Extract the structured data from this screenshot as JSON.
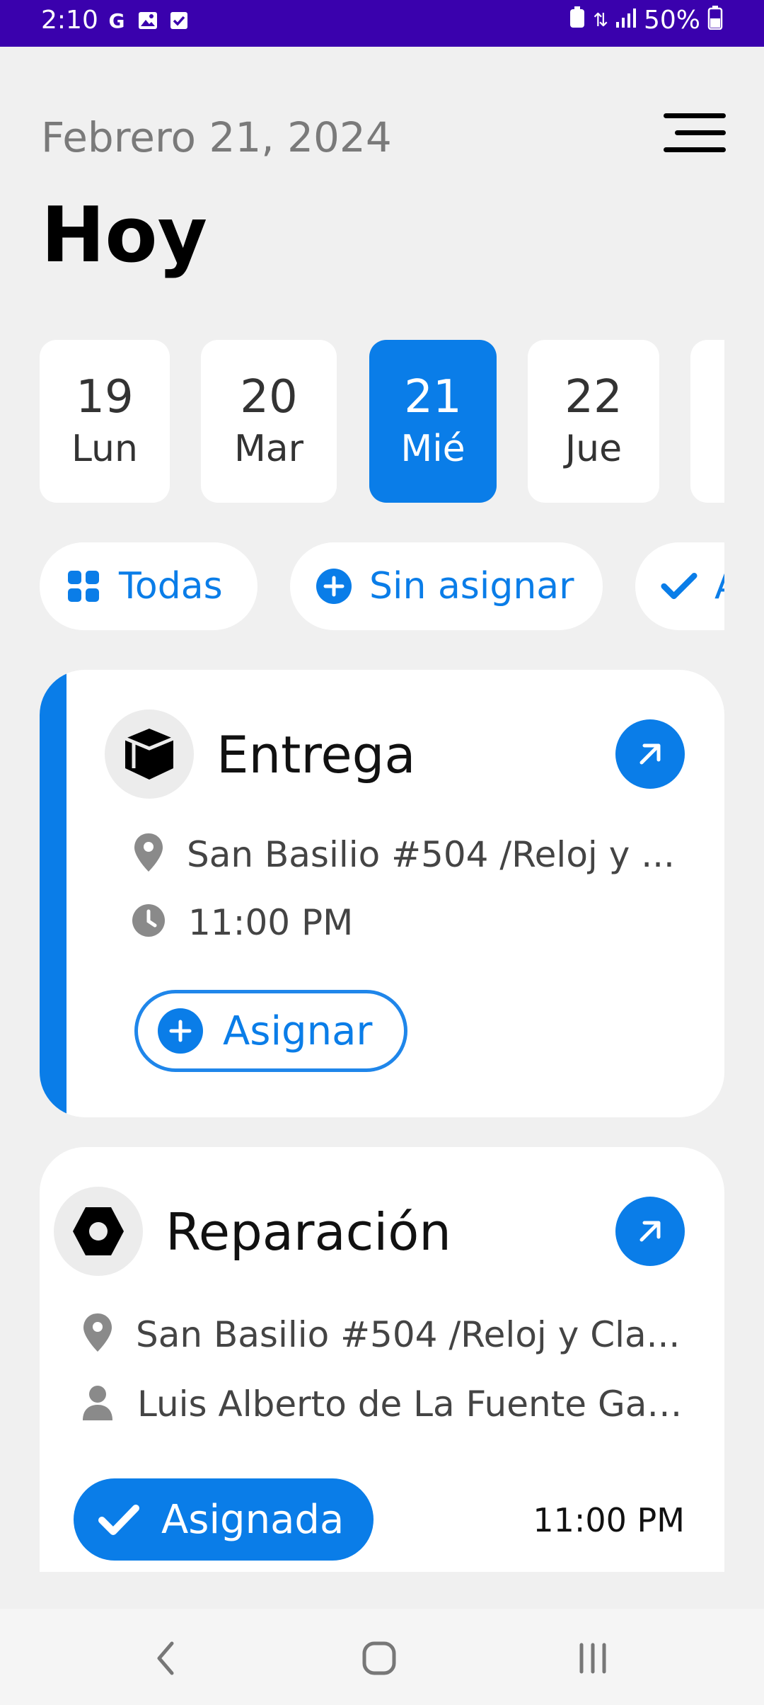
{
  "status_bar": {
    "time": "2:10",
    "battery": "50%",
    "bg_color": "#3a01ad"
  },
  "header": {
    "date": "Febrero 21, 2024",
    "title": "Hoy",
    "menu_icon": "hamburger-menu-icon"
  },
  "days": [
    {
      "num": "19",
      "weekday": "Lun",
      "selected": false
    },
    {
      "num": "20",
      "weekday": "Mar",
      "selected": false
    },
    {
      "num": "21",
      "weekday": "Mié",
      "selected": true
    },
    {
      "num": "22",
      "weekday": "Jue",
      "selected": false
    }
  ],
  "filters": [
    {
      "label": "Todas",
      "icon": "grid-icon"
    },
    {
      "label": "Sin asignar",
      "icon": "plus-circle-icon"
    },
    {
      "label": "A",
      "icon": "check-icon"
    }
  ],
  "tasks": [
    {
      "type": "Entrega",
      "type_icon": "cube-icon",
      "address": "San Basilio #504 /Reloj y ...",
      "time": "11:00 PM",
      "action_label": "Asignar",
      "unassigned": true
    },
    {
      "type": "Reparación",
      "type_icon": "nut-icon",
      "address": "San Basilio #504 /Reloj y Cla...",
      "assignee": "Luis Alberto de La Fuente Garc...",
      "status_label": "Asignada",
      "time": "11:00 PM",
      "unassigned": false
    }
  ],
  "colors": {
    "accent": "#0a7de8",
    "background": "#f0f0f0"
  }
}
